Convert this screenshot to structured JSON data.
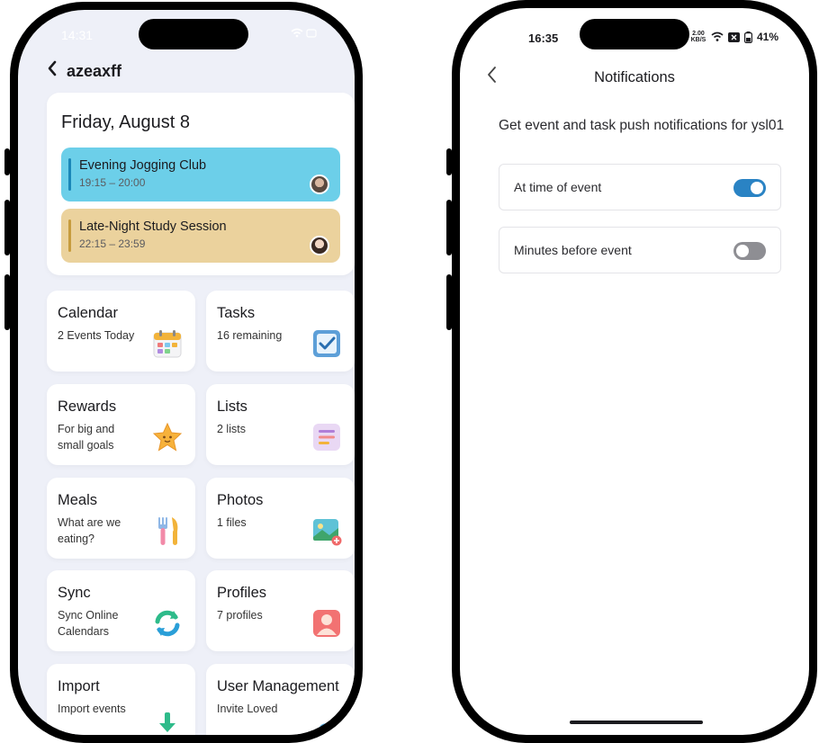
{
  "left_phone": {
    "status_time": "14:31",
    "header": {
      "back_icon": "chevron-left-icon",
      "profile_name": "azeaxff"
    },
    "day_card": {
      "title": "Friday, August 8",
      "events": [
        {
          "title": "Evening Jogging Club",
          "time": "19:15 – 20:00",
          "color": "#6ccfe9"
        },
        {
          "title": "Late-Night Study Session",
          "time": "22:15 – 23:59",
          "color": "#ebd29d"
        }
      ]
    },
    "tiles": [
      {
        "title": "Calendar",
        "subtitle": "2 Events Today",
        "icon": "calendar-icon"
      },
      {
        "title": "Tasks",
        "subtitle": "16 remaining",
        "icon": "checkbox-icon"
      },
      {
        "title": "Rewards",
        "subtitle": "For big and small goals",
        "icon": "star-icon"
      },
      {
        "title": "Lists",
        "subtitle": "2 lists",
        "icon": "list-icon"
      },
      {
        "title": "Meals",
        "subtitle": "What are we eating?",
        "icon": "fork-knife-icon"
      },
      {
        "title": "Photos",
        "subtitle": "1 files",
        "icon": "photo-icon"
      },
      {
        "title": "Sync",
        "subtitle": "Sync Online Calendars",
        "icon": "sync-icon"
      },
      {
        "title": "Profiles",
        "subtitle": "7 profiles",
        "icon": "profile-icon"
      },
      {
        "title": "Import",
        "subtitle": "Import events",
        "icon": "import-icon"
      },
      {
        "title": "User Management",
        "subtitle": "Invite Loved",
        "icon": "gear-icon"
      }
    ]
  },
  "right_phone": {
    "status_time": "16:35",
    "status_speed": "2.00 KB/S",
    "status_battery": "41%",
    "nav": {
      "back_icon": "chevron-left-icon",
      "title": "Notifications"
    },
    "description": "Get event and task push notifications for ysl01",
    "settings": [
      {
        "label": "At time of event",
        "enabled": true
      },
      {
        "label": "Minutes before event",
        "enabled": false
      }
    ],
    "colors": {
      "toggle_on": "#2a83c4",
      "toggle_off": "#8e8e93"
    }
  }
}
